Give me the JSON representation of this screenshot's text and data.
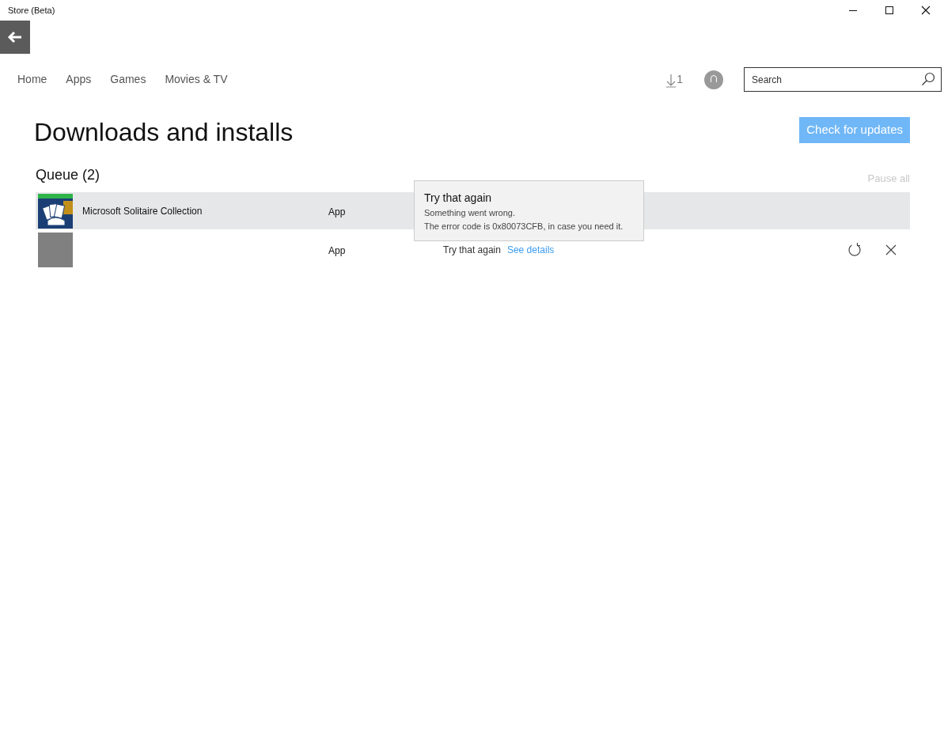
{
  "window": {
    "title": "Store (Beta)"
  },
  "nav": {
    "items": [
      "Home",
      "Apps",
      "Games",
      "Movies & TV"
    ],
    "downloads_count": "1",
    "search": {
      "placeholder": "Search"
    }
  },
  "page": {
    "title": "Downloads and installs",
    "check_button": "Check for updates"
  },
  "queue": {
    "title": "Queue (2)",
    "pause_all": {
      "label": "Pause all",
      "disabled": true
    },
    "items": [
      {
        "kind": "solitaire",
        "name": "Microsoft Solitaire Collection",
        "type": "App",
        "highlighted": true
      },
      {
        "kind": "blank",
        "type": "App",
        "highlighted": false,
        "status": "Try that again",
        "link": "See details",
        "actions": true
      }
    ]
  },
  "tooltip": {
    "title": "Try that again",
    "lines": [
      "Something went wrong.",
      "The error code is 0x80073CFB, in case you need it."
    ]
  }
}
